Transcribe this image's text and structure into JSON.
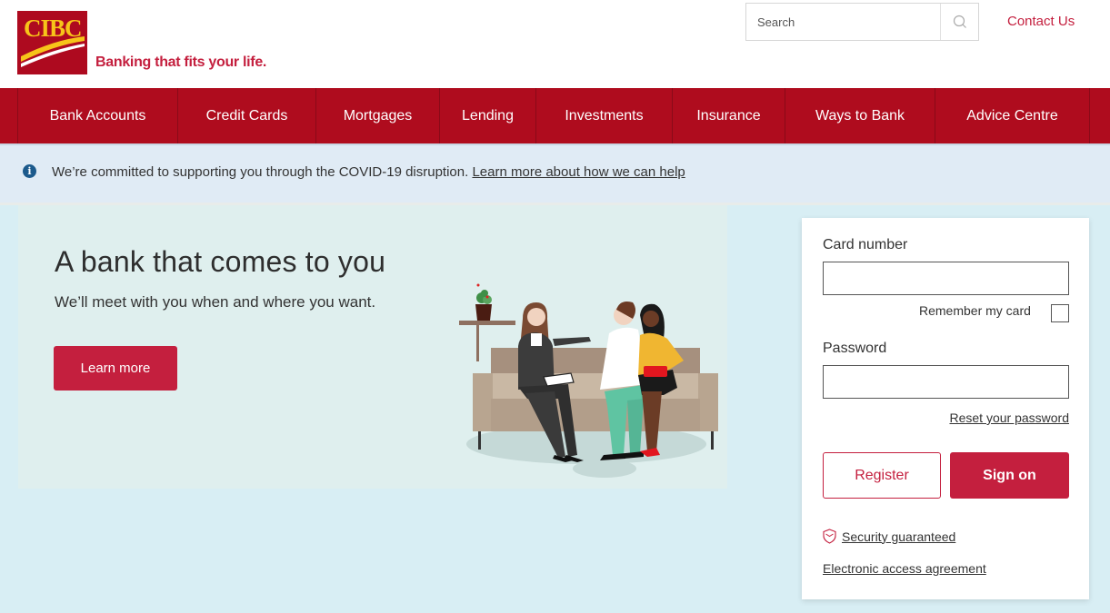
{
  "header": {
    "logo_text": "CIBC",
    "tagline": "Banking that fits your life.",
    "search_placeholder": "Search",
    "contact_label": "Contact Us"
  },
  "nav": {
    "items": [
      {
        "label": "Bank Accounts"
      },
      {
        "label": "Credit Cards"
      },
      {
        "label": "Mortgages"
      },
      {
        "label": "Lending"
      },
      {
        "label": "Investments"
      },
      {
        "label": "Insurance"
      },
      {
        "label": "Ways to Bank"
      },
      {
        "label": "Advice Centre"
      }
    ]
  },
  "notice": {
    "icon": "info-icon",
    "text": "We’re committed to supporting you through the COVID-19 disruption. ",
    "link_label": "Learn more about how we can help"
  },
  "hero": {
    "title": "A bank that comes to you",
    "subtitle": "We’ll meet with you when and where you want.",
    "button_label": "Learn more",
    "illustration": "advisor-meeting-couple-on-sofa"
  },
  "signon": {
    "card_label": "Card number",
    "card_value": "",
    "remember_label": "Remember my card",
    "remember_checked": false,
    "password_label": "Password",
    "password_value": "",
    "reset_label": "Reset your password",
    "register_label": "Register",
    "signon_label": "Sign on",
    "security_label": "Security guaranteed",
    "agreement_label": "Electronic access agreement"
  },
  "colors": {
    "brand_red": "#c41f3e",
    "nav_red": "#af0c1e",
    "logo_yellow": "#f7c419",
    "page_bg": "#d8eef4",
    "notice_bg": "#e0ebf5"
  }
}
